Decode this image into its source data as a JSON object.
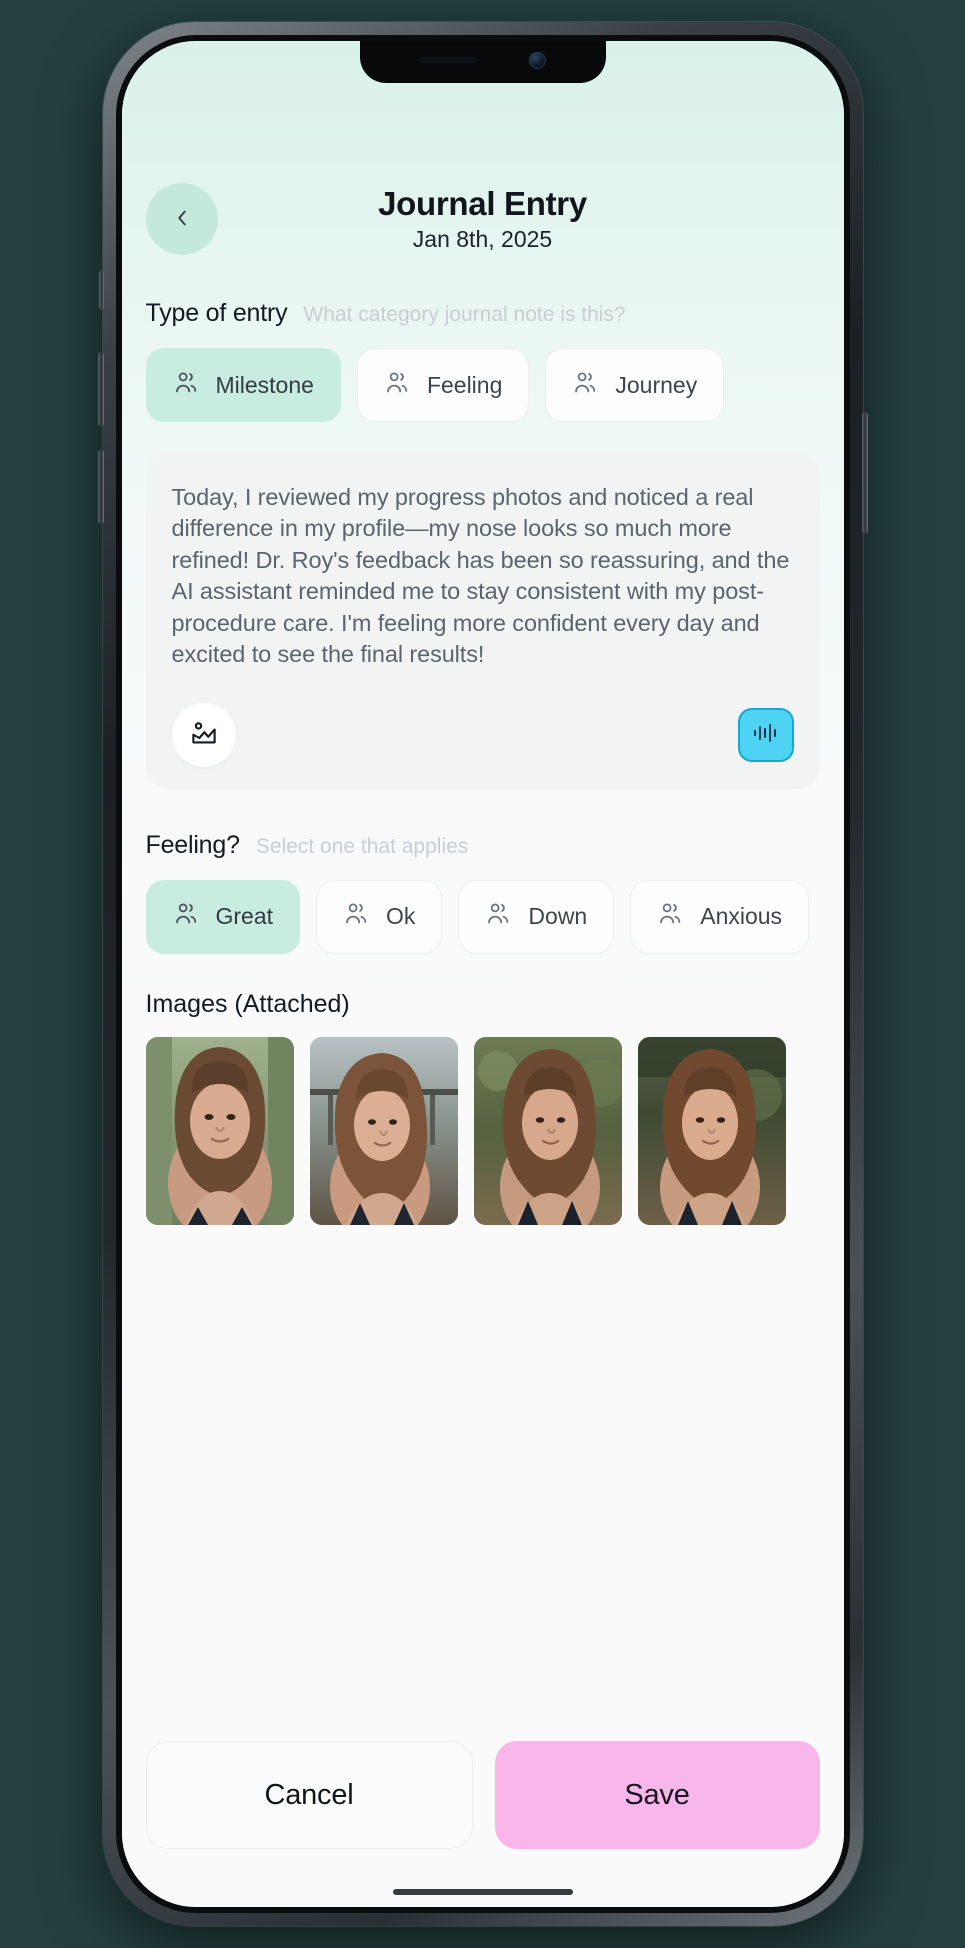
{
  "header": {
    "back_icon": "chevron-left-icon",
    "title": "Journal Entry",
    "date": "Jan 8th, 2025"
  },
  "type_section": {
    "label": "Type of entry",
    "hint": "What category journal note is this?",
    "options": [
      {
        "label": "Milestone",
        "icon": "users-icon",
        "selected": true
      },
      {
        "label": "Feeling",
        "icon": "users-icon",
        "selected": false
      },
      {
        "label": "Journey",
        "icon": "users-icon",
        "selected": false
      }
    ]
  },
  "note": {
    "text": "Today, I reviewed my progress photos and noticed a real difference in my profile—my nose looks so much more refined! Dr. Roy's feedback has been so reassuring, and the AI assistant reminded me to stay consistent with my post-procedure care. I'm feeling more confident every day and excited to see the final results!",
    "attach_image_icon": "image-icon",
    "voice_icon": "audio-waveform-icon"
  },
  "feeling_section": {
    "label": "Feeling?",
    "hint": "Select one that applies",
    "options": [
      {
        "label": "Great",
        "icon": "users-icon",
        "selected": true
      },
      {
        "label": "Ok",
        "icon": "users-icon",
        "selected": false
      },
      {
        "label": "Down",
        "icon": "users-icon",
        "selected": false
      },
      {
        "label": "Anxious",
        "icon": "users-icon",
        "selected": false
      }
    ]
  },
  "images_section": {
    "label": "Images (Attached)",
    "thumbnails": [
      {
        "name": "attached-photo-1"
      },
      {
        "name": "attached-photo-2"
      },
      {
        "name": "attached-photo-3"
      },
      {
        "name": "attached-photo-4"
      }
    ]
  },
  "footer": {
    "cancel_label": "Cancel",
    "save_label": "Save"
  },
  "colors": {
    "selected_chip": "#c9ece1",
    "back_button": "#c5e8dc",
    "save_button": "#f9b6ea",
    "voice_button": "#4fd3f5",
    "note_card": "#f2f4f4"
  }
}
